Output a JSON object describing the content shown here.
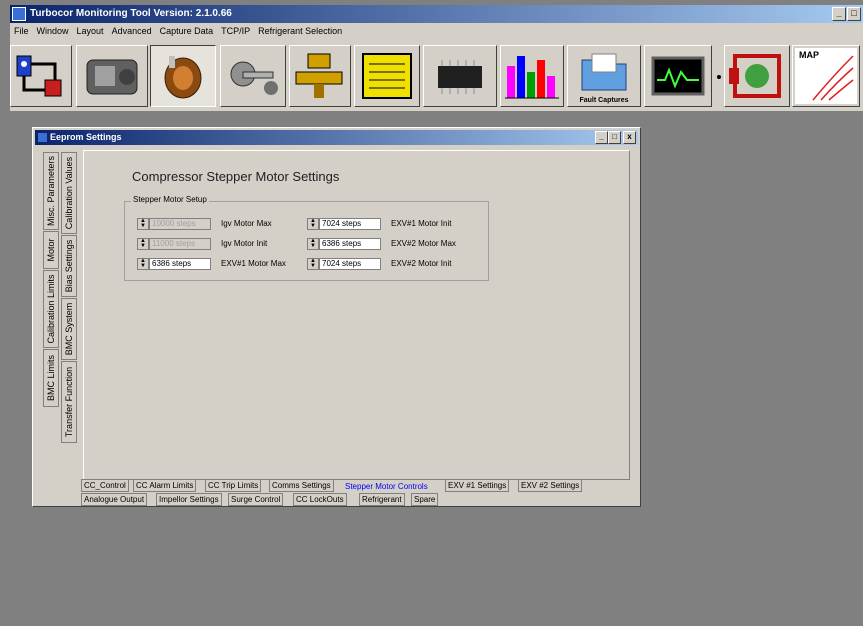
{
  "app": {
    "title": "Turbocor Monitoring Tool Version: 2.1.0.66",
    "window_buttons": [
      "_",
      "□"
    ]
  },
  "menu": [
    "File",
    "Window",
    "Layout",
    "Advanced",
    "Capture Data",
    "TCP/IP",
    "Refrigerant Selection"
  ],
  "toolbar": {
    "fault_captures_label": "Fault Captures",
    "map_label": "MAP"
  },
  "eeprom": {
    "title": "Eeprom Settings",
    "buttons": [
      "_",
      "□",
      "x"
    ],
    "vertical_tabs_col1": [
      "Misc. Parameters",
      "Motor",
      "Calibration Limits",
      "BMC Limits"
    ],
    "vertical_tabs_col2": [
      "Calibration Values",
      "Bias Settings",
      "BMC System",
      "Transfer Function"
    ],
    "panel_title": "Compressor Stepper Motor Settings",
    "group_label": "Stepper Motor Setup",
    "fields": [
      {
        "value": "10000 steps",
        "label": "Igv Motor Max"
      },
      {
        "value": "11000 steps",
        "label": "Igv Motor Init"
      },
      {
        "value": "6386 steps",
        "label": "EXV#1 Motor Max"
      },
      {
        "value": "7024 steps",
        "label": "EXV#1 Motor Init"
      },
      {
        "value": "6386 steps",
        "label": "EXV#2 Motor Max"
      },
      {
        "value": "7024 steps",
        "label": "EXV#2 Motor Init"
      }
    ],
    "bottom_tabs_row1": [
      "CC_Control",
      "CC Alarm Limits",
      "CC Trip Limits",
      "Comms Settings",
      "Stepper Motor Controls",
      "EXV #1 Settings",
      "EXV #2 Settings"
    ],
    "bottom_tabs_row2": [
      "Analogue Output",
      "Impellor Settings",
      "Surge Control",
      "CC LockOuts",
      "Refrigerant",
      "Spare"
    ]
  }
}
